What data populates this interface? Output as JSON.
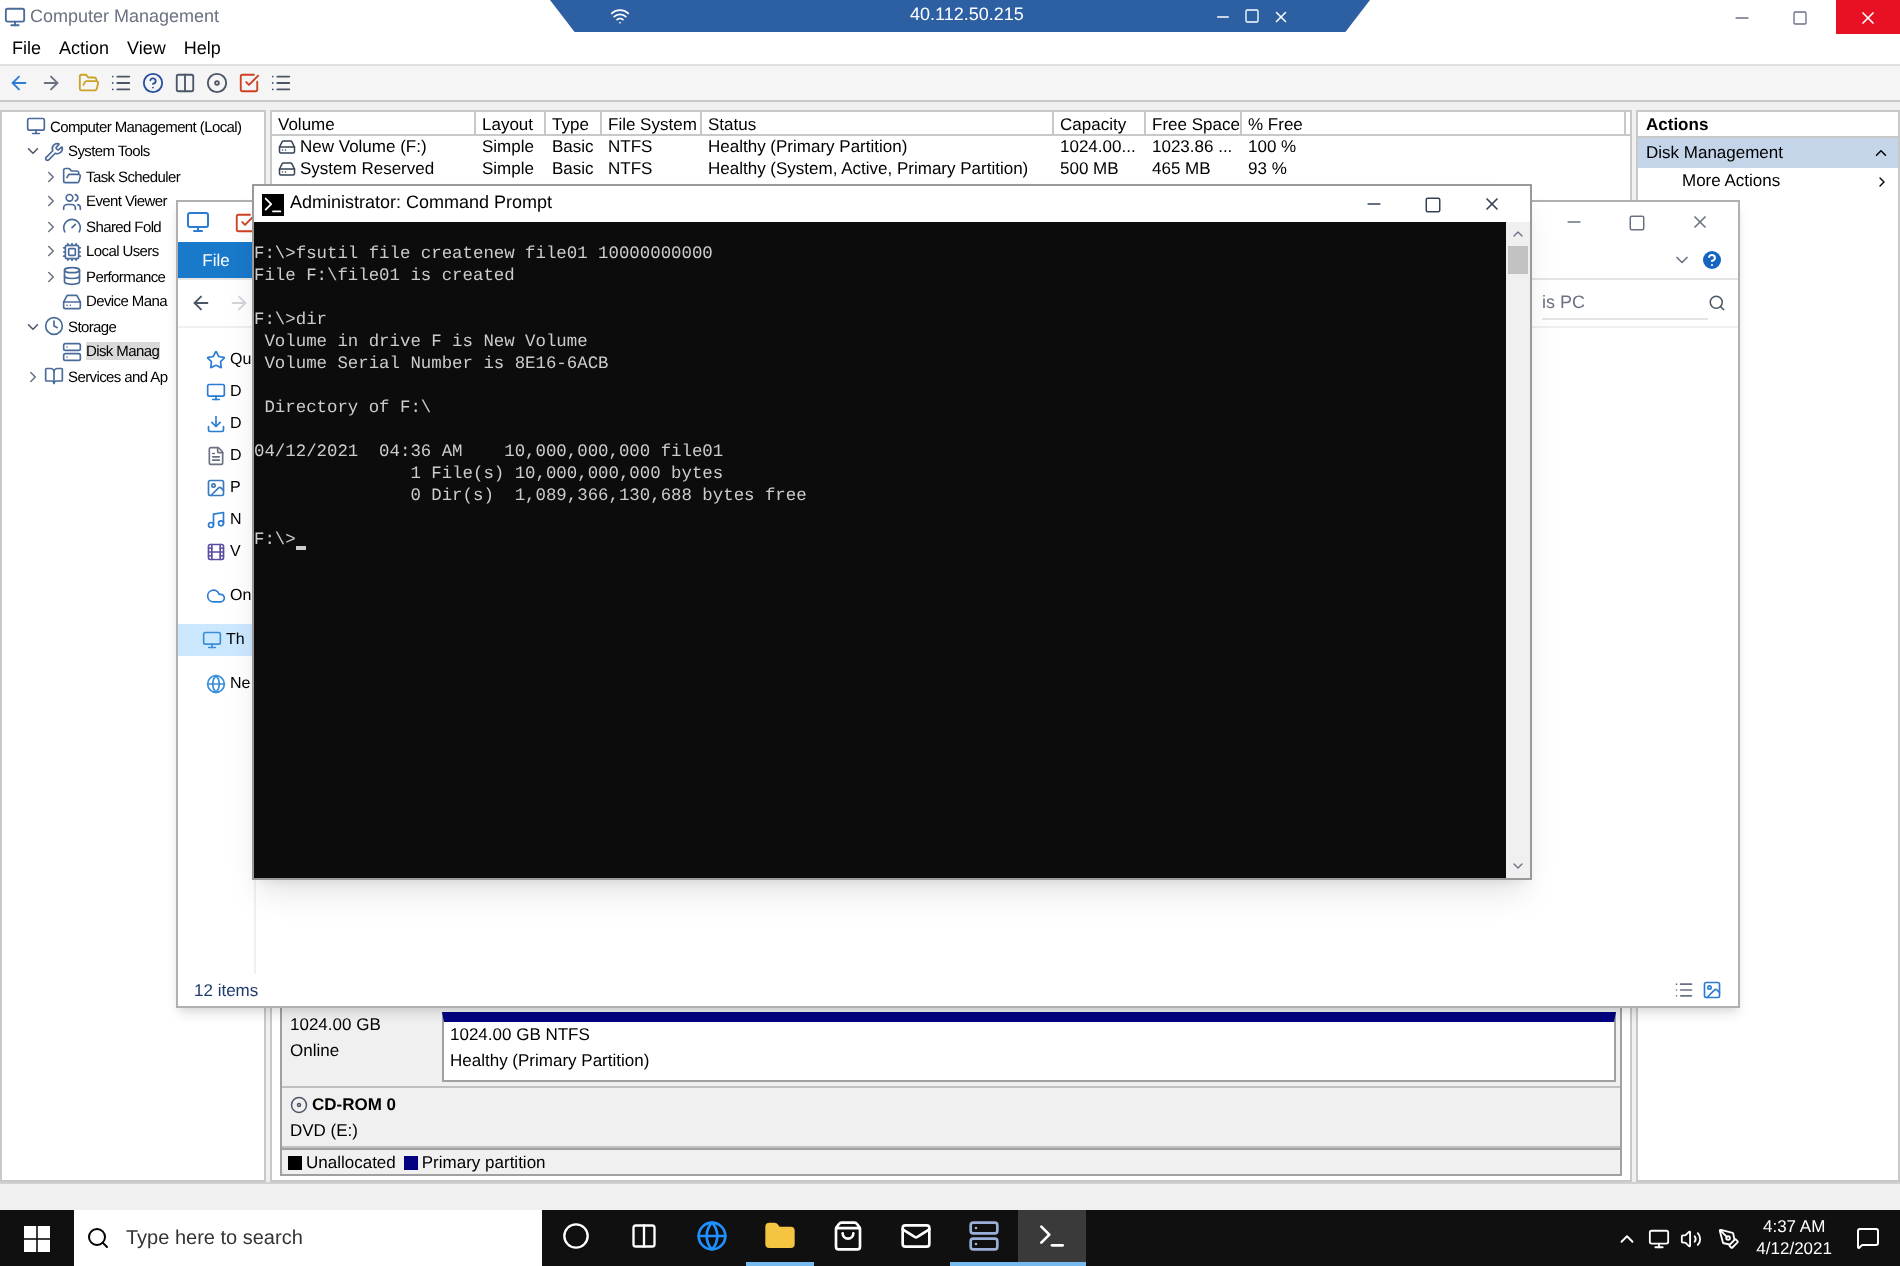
{
  "remote_bar": {
    "address": "40.112.50.215"
  },
  "mmc": {
    "title": "Computer Management",
    "menu": [
      "File",
      "Action",
      "View",
      "Help"
    ],
    "tree": [
      {
        "label": "Computer Management (Local)",
        "selected": false,
        "children": [
          {
            "label": "System Tools",
            "expanded": true,
            "selected": false,
            "children": [
              {
                "label": "Task Scheduler",
                "expanded": false,
                "selected": false
              },
              {
                "label": "Event Viewer",
                "expanded": false,
                "selected": false
              },
              {
                "label": "Shared Fold",
                "expanded": false,
                "selected": false
              },
              {
                "label": "Local Users",
                "expanded": false,
                "selected": false
              },
              {
                "label": "Performance",
                "expanded": false,
                "selected": false
              },
              {
                "label": "Device Mana",
                "selected": false
              }
            ]
          },
          {
            "label": "Storage",
            "expanded": true,
            "selected": false,
            "children": [
              {
                "label": "Disk Manag",
                "selected": true
              }
            ]
          },
          {
            "label": "Services and Ap",
            "expanded": false,
            "selected": false
          }
        ]
      }
    ],
    "volume_table": {
      "columns": [
        "Volume",
        "Layout",
        "Type",
        "File System",
        "Status",
        "Capacity",
        "Free Space",
        "% Free"
      ],
      "rows": [
        [
          "New Volume (F:)",
          "Simple",
          "Basic",
          "NTFS",
          "Healthy (Primary Partition)",
          "1024.00...",
          "1023.86 ...",
          "100 %"
        ],
        [
          "System Reserved",
          "Simple",
          "Basic",
          "NTFS",
          "Healthy (System, Active, Primary Partition)",
          "500 MB",
          "465 MB",
          "93 %"
        ]
      ]
    },
    "disks": [
      {
        "size": "1024.00 GB",
        "status": "Online",
        "partition_size": "1024.00 GB NTFS",
        "partition_status": "Healthy (Primary Partition)"
      },
      {
        "name": "CD-ROM 0",
        "size": "DVD (E:)"
      }
    ],
    "legend": [
      {
        "label": "Unallocated",
        "color": "#000000"
      },
      {
        "label": "Primary partition",
        "color": "#000080"
      }
    ],
    "actions": {
      "title": "Actions",
      "section": "Disk Management",
      "expanded": true,
      "items": [
        "More Actions"
      ]
    }
  },
  "explorer": {
    "ribbon_tab": "File",
    "search": {
      "placeholder": "is PC"
    },
    "nav": [
      {
        "label": "Qu",
        "selected": false
      },
      {
        "label": "D",
        "selected": false
      },
      {
        "label": "D",
        "selected": false
      },
      {
        "label": "D",
        "selected": false
      },
      {
        "label": "P",
        "selected": false
      },
      {
        "label": "N",
        "selected": false
      },
      {
        "label": "V",
        "selected": false
      },
      {
        "label": "On",
        "selected": false
      },
      {
        "label": "Th",
        "selected": true
      },
      {
        "label": "Ne",
        "selected": false
      }
    ],
    "status": "12 items"
  },
  "cmd": {
    "title": "Administrator: Command Prompt",
    "blocks": [
      [
        "F:\\>fsutil file createnew file01 10000000000",
        "File F:\\file01 is created"
      ],
      [
        "F:\\>dir",
        " Volume in drive F is New Volume",
        " Volume Serial Number is 8E16-6ACB"
      ],
      [
        " Directory of F:\\"
      ],
      [
        "04/12/2021  04:36 AM    10,000,000,000 file01",
        "               1 File(s) 10,000,000,000 bytes",
        "               0 Dir(s)  1,089,366,130,688 bytes free"
      ],
      [
        "F:\\>"
      ]
    ],
    "cursor": true
  },
  "taskbar": {
    "search_placeholder": "Type here to search",
    "apps": [
      {
        "kind": "cortana",
        "running": false,
        "selected": false
      },
      {
        "kind": "taskview",
        "running": false,
        "selected": false
      },
      {
        "kind": "edge",
        "running": false,
        "selected": false
      },
      {
        "kind": "explorer",
        "running": true,
        "selected": false
      },
      {
        "kind": "store",
        "running": false,
        "selected": false
      },
      {
        "kind": "mail",
        "running": false,
        "selected": false
      },
      {
        "kind": "server",
        "running": true,
        "selected": false
      },
      {
        "kind": "cmd",
        "running": true,
        "selected": true
      }
    ],
    "time": "4:37 AM",
    "date": "4/12/2021"
  }
}
